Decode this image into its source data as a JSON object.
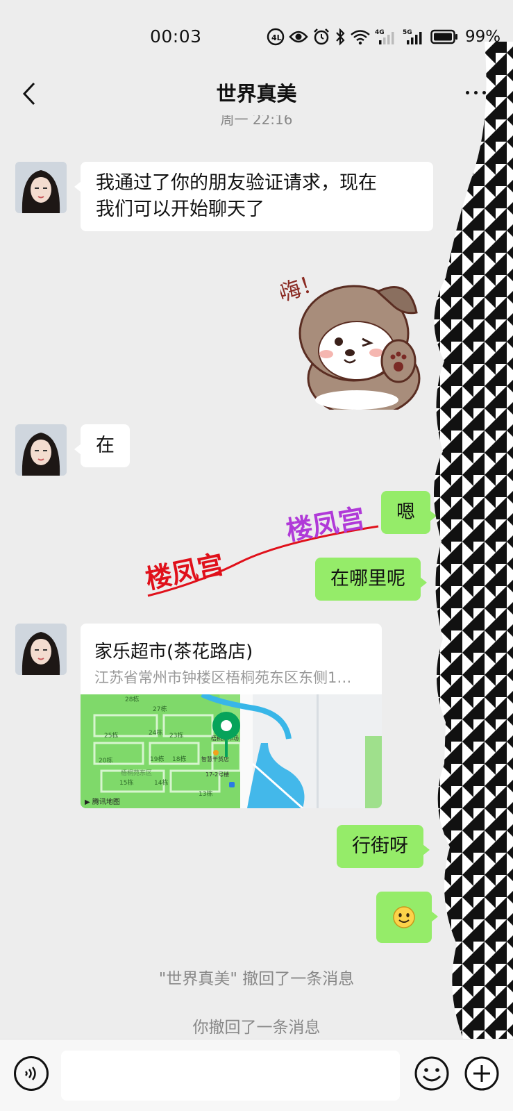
{
  "status_bar": {
    "time": "00:03",
    "battery": "99%",
    "network_1": "4G",
    "network_2": "5G"
  },
  "header": {
    "title": "世界真美",
    "back_icon": "chevron-left-icon",
    "more_icon": "more-dots-icon"
  },
  "time_separator": "周一 22:16",
  "messages": [
    {
      "side": "in",
      "text_line1": "我通过了你的朋友验证请求，现在",
      "text_line2": "我们可以开始聊天了"
    },
    {
      "side": "in",
      "type": "sticker",
      "sticker_text": "嗨！"
    },
    {
      "side": "in",
      "text": "在"
    },
    {
      "side": "out",
      "text": "嗯"
    },
    {
      "side": "out",
      "text": "在哪里呢"
    },
    {
      "side": "in",
      "type": "location",
      "name": "家乐超市(茶花路店)",
      "address": "江苏省常州市钟楼区梧桐苑东区东侧1…",
      "map_credit": "腾讯地图"
    },
    {
      "side": "out",
      "text": "行街呀"
    },
    {
      "side": "out",
      "type": "emoji",
      "emoji": "😊"
    }
  ],
  "watermark": {
    "text_1": "楼凤宫",
    "text_2": "楼凤宫"
  },
  "map_labels": [
    "28栋",
    "27栋",
    "25栋",
    "24栋",
    "23栋",
    "20栋",
    "19栋",
    "18栋",
    "15栋",
    "14栋",
    "13栋",
    "梧桐苑东区",
    "智慧干货店",
    "梧桐菜市场",
    "17-2号楼"
  ],
  "system_messages": [
    "\"世界真美\" 撤回了一条消息",
    "你撤回了一条消息"
  ],
  "input_bar": {
    "placeholder": "",
    "voice_icon": "voice-icon",
    "emoji_icon": "emoji-icon",
    "plus_icon": "plus-icon"
  },
  "colors": {
    "background": "#ededed",
    "outgoing_bubble": "#95ec69",
    "incoming_bubble": "#ffffff",
    "map_pin": "#07a35a"
  }
}
